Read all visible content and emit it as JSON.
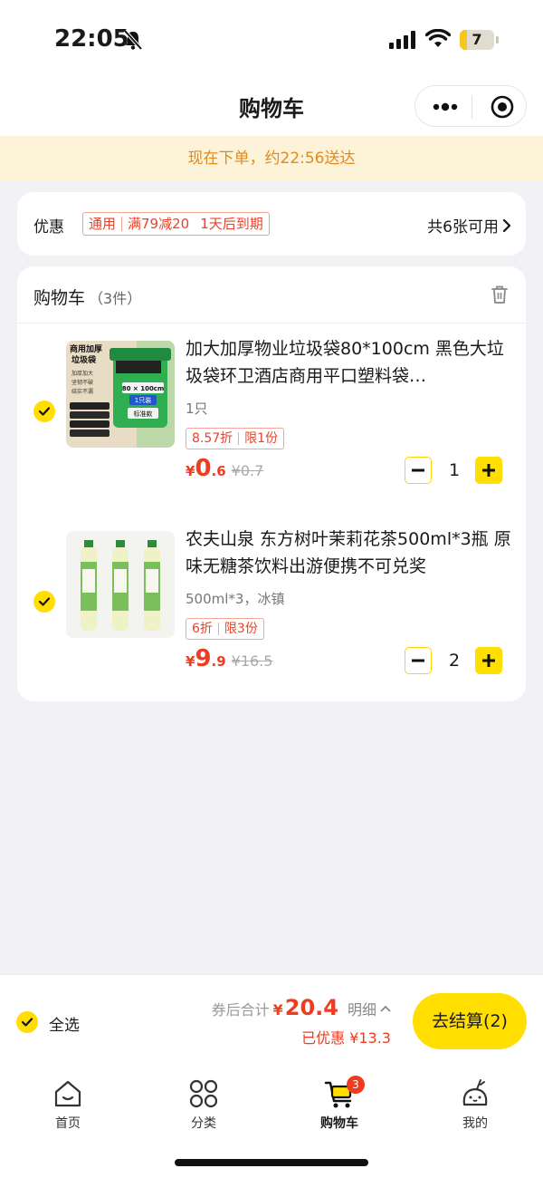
{
  "status_bar": {
    "time": "22:05",
    "battery": "7",
    "battery_level": 0.07
  },
  "nav": {
    "title": "购物车"
  },
  "notice": {
    "text": "现在下单，约22:56送达"
  },
  "coupon": {
    "label": "优惠",
    "tag_parts": [
      "通用",
      "满79减20",
      "1天后到期"
    ],
    "count_text": "共6张可用"
  },
  "cart": {
    "title": "购物车",
    "count": "（3件）",
    "items": [
      {
        "name": "加大加厚物业垃圾袋80*100cm 黑色大垃圾袋环卫酒店商用平口塑料袋…",
        "spec": "1只",
        "promo": [
          "8.57折",
          "限1份"
        ],
        "currency": "¥",
        "price_int": "0",
        "price_dec": ".6",
        "orig_price": "¥0.7",
        "qty": "1",
        "thumb_text": [
          "商用加厚",
          "垃圾袋",
          "加厚加大",
          "坚韧不破",
          "结实不漏",
          "80 × 100cm",
          "1只装",
          "标准款"
        ]
      },
      {
        "name": "农夫山泉 东方树叶茉莉花茶500ml*3瓶 原味无糖茶饮料出游便携不可兑奖",
        "spec": "500ml*3，冰镇",
        "promo": [
          "6折",
          "限3份"
        ],
        "currency": "¥",
        "price_int": "9",
        "price_dec": ".9",
        "orig_price": "¥16.5",
        "qty": "2"
      }
    ]
  },
  "checkout": {
    "select_all": "全选",
    "total_label": "券后合计",
    "currency": "¥",
    "total": "20.4",
    "detail": "明细",
    "saved": "已优惠 ¥13.3",
    "button": "去结算(2)"
  },
  "tabs": [
    {
      "label": "首页",
      "icon": "home-icon"
    },
    {
      "label": "分类",
      "icon": "category-icon"
    },
    {
      "label": "购物车",
      "icon": "cart-icon",
      "badge": "3",
      "active": true
    },
    {
      "label": "我的",
      "icon": "profile-icon"
    }
  ],
  "colors": {
    "accent": "#ffde00",
    "price": "#f03c1e",
    "notice_bg": "#fdf3d8",
    "notice_text": "#e08a1c"
  }
}
